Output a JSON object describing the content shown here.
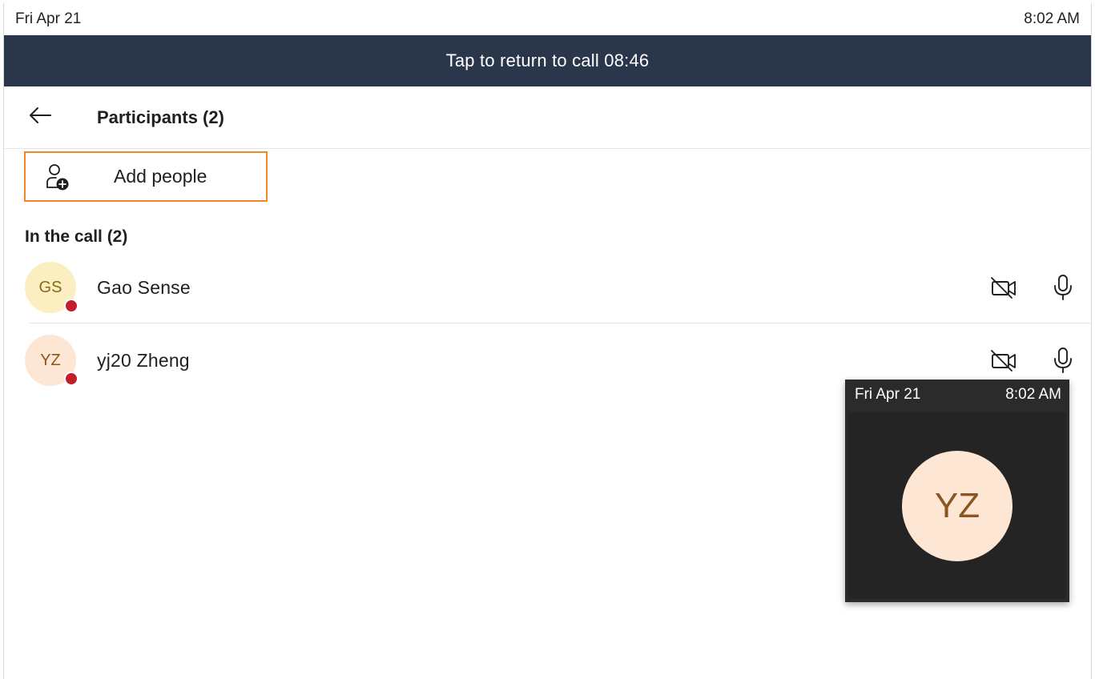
{
  "status_bar": {
    "date": "Fri Apr 21",
    "time": "8:02 AM"
  },
  "return_bar": {
    "label": "Tap to return to call 08:46",
    "color": "#2a374b"
  },
  "header": {
    "back_icon": "arrow-left-icon",
    "title": "Participants (2)"
  },
  "add_people": {
    "icon": "add-person-icon",
    "label": "Add people",
    "highlight_color": "#ef8a23"
  },
  "section": {
    "title": "In the call (2)"
  },
  "participants": [
    {
      "initials": "GS",
      "name": "Gao  Sense",
      "presence_color": "#c41e2c",
      "video_icon": "video-off-icon",
      "mic_icon": "microphone-icon"
    },
    {
      "initials": "YZ",
      "name": "yj20 Zheng",
      "presence_color": "#c41e2c",
      "video_icon": "video-off-icon",
      "mic_icon": "microphone-icon"
    }
  ],
  "pip": {
    "date": "Fri Apr 21",
    "time": "8:02 AM",
    "initials": "YZ"
  }
}
